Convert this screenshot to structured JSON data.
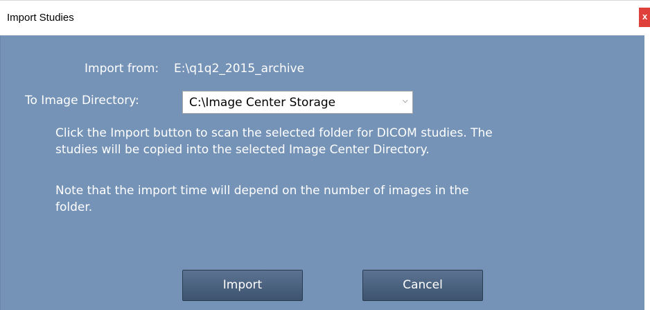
{
  "window": {
    "title": "Import Studies",
    "close_label": "x"
  },
  "form": {
    "import_from_label": "Import from:",
    "import_from_value": "E:\\q1q2_2015_archive",
    "to_directory_label": "To Image Directory:",
    "directory_selected": "C:\\Image Center Storage",
    "dropdown_icon": "chevron-down-icon"
  },
  "info": {
    "paragraph_1": "Click the Import button to scan the selected folder for DICOM studies. The studies will be copied into the selected Image Center Directory.",
    "paragraph_2": "Note that the import time will depend on the number of images in the folder."
  },
  "buttons": {
    "import_label": "Import",
    "cancel_label": "Cancel"
  },
  "colors": {
    "background": "#7593b7",
    "button": "#4b6280",
    "close": "#e0403a"
  }
}
